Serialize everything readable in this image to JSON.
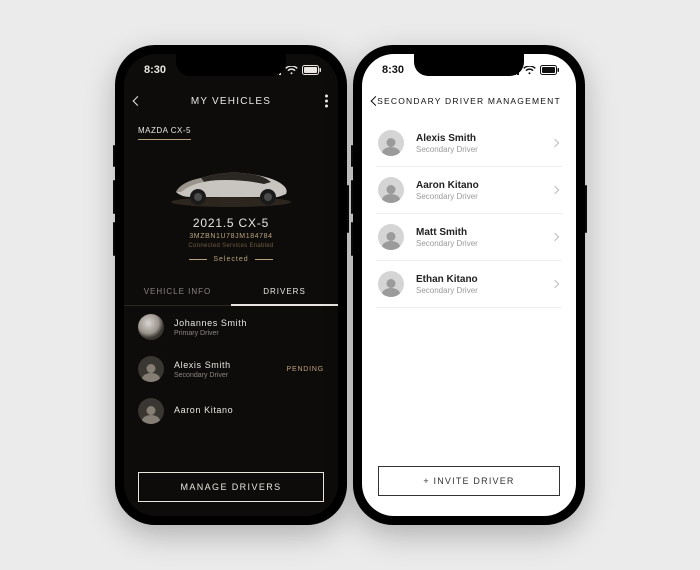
{
  "status": {
    "time": "8:30"
  },
  "left": {
    "title": "MY VEHICLES",
    "vehicle_tab": "MAZDA CX-5",
    "car_name": "2021.5 CX-5",
    "vin": "3MZBN1U78JM184784",
    "services": "Connected Services Enabled",
    "selected": "Selected",
    "tabs": {
      "info": "VEHICLE INFO",
      "drivers": "DRIVERS"
    },
    "drivers": [
      {
        "name": "Johannes Smith",
        "role": "Primary Driver",
        "status": ""
      },
      {
        "name": "Alexis Smith",
        "role": "Secondary Driver",
        "status": "PENDING"
      },
      {
        "name": "Aaron Kitano",
        "role": "",
        "status": ""
      }
    ],
    "manage_label": "MANAGE DRIVERS"
  },
  "right": {
    "title": "SECONDARY DRIVER MANAGEMENT",
    "drivers": [
      {
        "name": "Alexis Smith",
        "role": "Secondary Driver"
      },
      {
        "name": "Aaron Kitano",
        "role": "Secondary Driver"
      },
      {
        "name": "Matt Smith",
        "role": "Secondary Driver"
      },
      {
        "name": "Ethan Kitano",
        "role": "Secondary Driver"
      }
    ],
    "invite_label": "+ INVITE DRIVER"
  }
}
